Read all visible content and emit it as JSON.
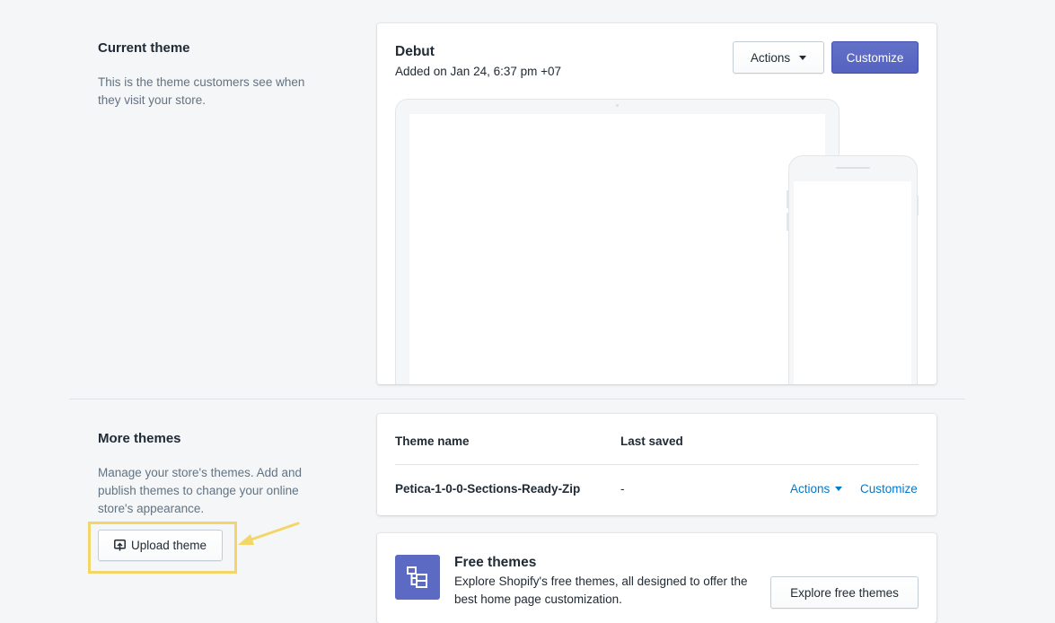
{
  "current_theme": {
    "section_title": "Current theme",
    "description": "This is the theme customers see when they visit your store.",
    "theme_name": "Debut",
    "added_on": "Added on Jan 24, 6:37 pm +07",
    "actions_label": "Actions",
    "customize_label": "Customize"
  },
  "more_themes": {
    "section_title": "More themes",
    "description": "Manage your store's themes. Add and publish themes to change your online store's appearance.",
    "upload_label": "Upload theme",
    "table": {
      "columns": [
        "Theme name",
        "Last saved"
      ],
      "rows": [
        {
          "name": "Petica-1-0-0-Sections-Ready-Zip",
          "last_saved": "-",
          "actions_label": "Actions",
          "customize_label": "Customize"
        }
      ]
    }
  },
  "free_themes": {
    "title": "Free themes",
    "description": "Explore Shopify's free themes, all designed to offer the best home page customization.",
    "button_label": "Explore free themes"
  },
  "colors": {
    "primary": "#5c6ac4",
    "link": "#007ace",
    "highlight": "#f3d667"
  }
}
